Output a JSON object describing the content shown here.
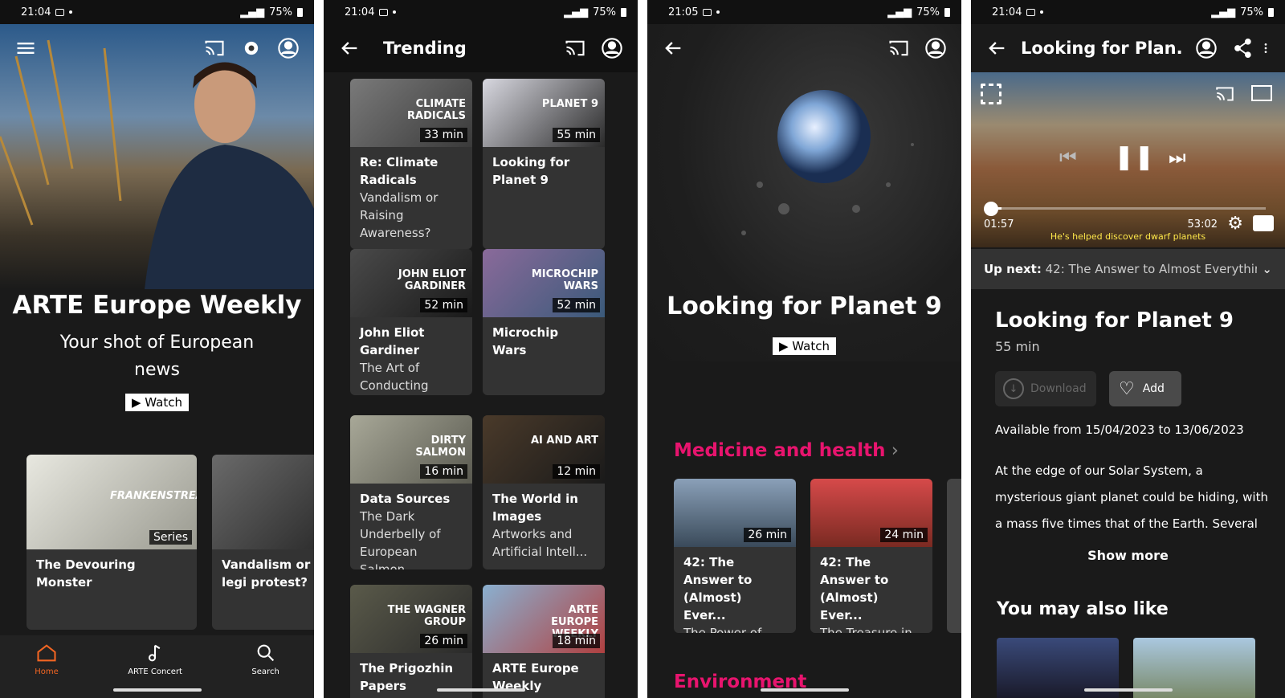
{
  "status": {
    "time1": "21:04",
    "time2": "21:04",
    "time3": "21:05",
    "time4": "21:04",
    "battery": "75%"
  },
  "home": {
    "hero_title": "ARTE Europe Weekly",
    "hero_sub": "Your shot of European news",
    "watch": "Watch",
    "cards": [
      {
        "title": "The Devouring Monster",
        "badge": "Series",
        "overlay": "FRANKENSTREAM"
      },
      {
        "title": "Vandalism or legi protest?"
      }
    ],
    "nav": [
      {
        "label": "Home"
      },
      {
        "label": "ARTE Concert"
      },
      {
        "label": "Search"
      }
    ]
  },
  "trending": {
    "title": "Trending",
    "items": [
      {
        "t": "Re: Climate Radicals",
        "s": "Vandalism or Raising Awareness?",
        "dur": "33 min",
        "overlay": "CLIMATE RADICALS"
      },
      {
        "t": "Looking for Planet 9",
        "s": "",
        "dur": "55 min",
        "overlay": "PLANET 9"
      },
      {
        "t": "John Eliot Gardiner",
        "s": "The Art of Conducting",
        "dur": "52 min",
        "overlay": "JOHN ELIOT GARDINER"
      },
      {
        "t": "Microchip Wars",
        "s": "",
        "dur": "52 min",
        "overlay": "MICROCHIP WARS"
      },
      {
        "t": "Data Sources",
        "s": "The Dark Underbelly of European Salmon",
        "dur": "16 min",
        "overlay": "DIRTY SALMON"
      },
      {
        "t": "The World in Images",
        "s": "Artworks and Artificial Intell...",
        "dur": "12 min",
        "overlay": "AI AND ART"
      },
      {
        "t": "The Prigozhin Papers",
        "s": "",
        "dur": "26 min",
        "overlay": "THE WAGNER GROUP"
      },
      {
        "t": "ARTE Europe Weekly",
        "s": "",
        "dur": "18 min",
        "overlay": "ARTE EUROPE WEEKLY"
      }
    ]
  },
  "planet": {
    "title": "Looking for Planet 9",
    "watch": "Watch",
    "section1": "Medicine and health",
    "section2": "Environment",
    "cards": [
      {
        "t": "42: The Answer to (Almost) Ever...",
        "s": "The Power of Dreams",
        "dur": "26 min"
      },
      {
        "t": "42: The Answer to (Almost) Ever...",
        "s": "The Treasure in Our Sewers",
        "dur": "24 min"
      }
    ]
  },
  "player": {
    "title": "Looking for Plan...",
    "elapsed": "01:57",
    "total": "53:02",
    "subtitle": "He's helped discover dwarf planets",
    "upnext_label": "Up next:",
    "upnext": "42: The Answer to Almost Everythin...",
    "heading": "Looking for Planet 9",
    "duration": "55 min",
    "download": "Download",
    "add": "Add",
    "available": "Available from 15/04/2023 to 13/06/2023",
    "description": "At the edge of our Solar System, a mysterious giant planet could be hiding, with a mass five times that of the Earth. Several teams of ...",
    "show_more": "Show more",
    "also_like": "You may also like",
    "progress": 0.04
  },
  "colors": {
    "accent": "#e8146e",
    "home_active": "#f26522"
  }
}
